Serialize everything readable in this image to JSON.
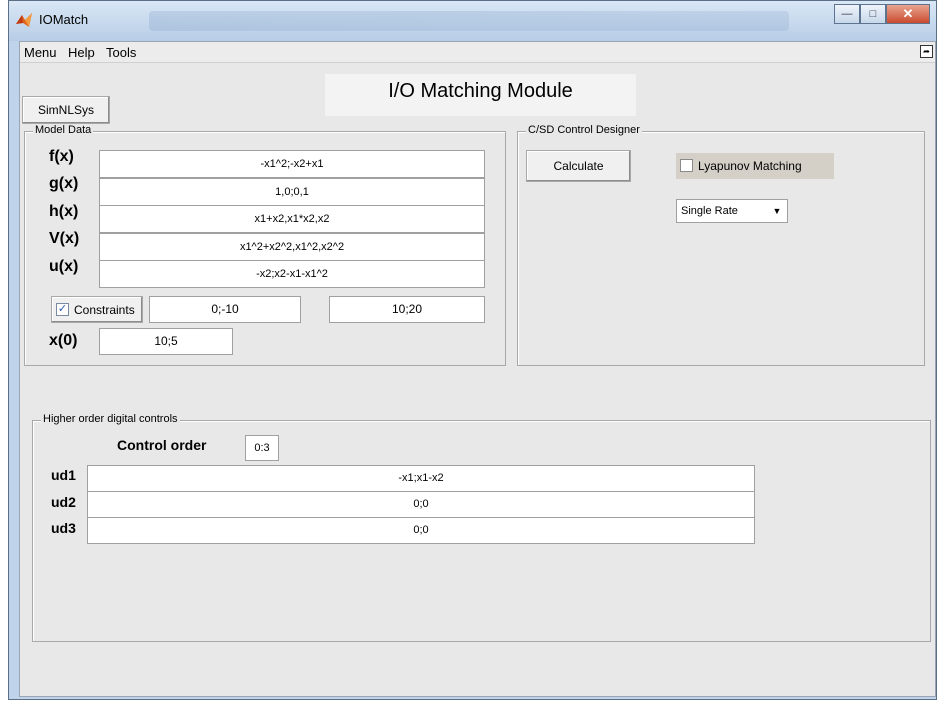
{
  "window": {
    "title": "IOMatch"
  },
  "menu": {
    "items": [
      "Menu",
      "Help",
      "Tools"
    ]
  },
  "header": {
    "title": "I/O Matching Module"
  },
  "toolbar": {
    "simnlsys_label": "SimNLSys"
  },
  "model_data": {
    "title": "Model Data",
    "rows": [
      {
        "label": "f(x)",
        "value": "-x1^2;-x2+x1"
      },
      {
        "label": "g(x)",
        "value": "1,0;0,1"
      },
      {
        "label": "h(x)",
        "value": "x1+x2,x1*x2,x2"
      },
      {
        "label": "V(x)",
        "value": "x1^2+x2^2,x1^2,x2^2"
      },
      {
        "label": "u(x)",
        "value": "-x2;x2-x1-x1^2"
      }
    ],
    "constraints": {
      "label": "Constraints",
      "checked": true,
      "lower": "0;-10",
      "upper": "10;20"
    },
    "x0": {
      "label": "x(0)",
      "value": "10;5"
    }
  },
  "csd": {
    "title": "C/SD Control Designer",
    "calculate_label": "Calculate",
    "lyapunov": {
      "label": "Lyapunov Matching",
      "checked": false
    },
    "rate": {
      "selected": "Single Rate"
    }
  },
  "higher_order": {
    "title": "Higher order digital controls",
    "control_order": {
      "label": "Control order",
      "value": "0:3"
    },
    "rows": [
      {
        "label": "ud1",
        "value": "-x1;x1-x2"
      },
      {
        "label": "ud2",
        "value": "0;0"
      },
      {
        "label": "ud3",
        "value": "0;0"
      }
    ]
  },
  "colors": {
    "title_gradient_top": "#d9e7f6",
    "client_bg": "#e8e8e8",
    "close_red": "#c94b2f"
  }
}
